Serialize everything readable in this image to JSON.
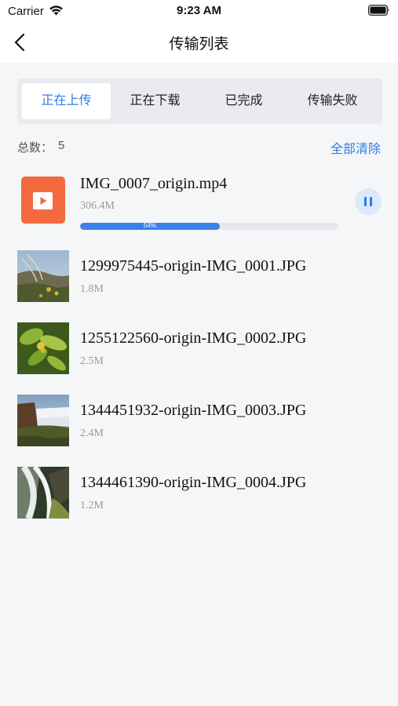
{
  "status_bar": {
    "carrier": "Carrier",
    "time": "9:23 AM"
  },
  "nav": {
    "title": "传输列表",
    "back_icon": "chevron-left-icon"
  },
  "tabs": [
    {
      "label": "正在上传",
      "active": true
    },
    {
      "label": "正在下载",
      "active": false
    },
    {
      "label": "已完成",
      "active": false
    },
    {
      "label": "传输失败",
      "active": false
    }
  ],
  "summary": {
    "label": "总数：",
    "count": "5",
    "clear_label": "全部清除"
  },
  "uploading": {
    "name": "IMG_0007_origin.mp4",
    "size": "306.4M",
    "progress": 0.54,
    "progress_label": "54%",
    "icon": "video-file-icon",
    "pause_icon": "pause-icon"
  },
  "files": [
    {
      "name": "1299975445-origin-IMG_0001.JPG",
      "size": "1.8M"
    },
    {
      "name": "1255122560-origin-IMG_0002.JPG",
      "size": "2.5M"
    },
    {
      "name": "1344451932-origin-IMG_0003.JPG",
      "size": "2.4M"
    },
    {
      "name": "1344461390-origin-IMG_0004.JPG",
      "size": "1.2M"
    }
  ],
  "colors": {
    "accent": "#2f7de1",
    "progress": "#3b82e8",
    "video_icon": "#f26a3e",
    "background": "#f5f6f8"
  }
}
